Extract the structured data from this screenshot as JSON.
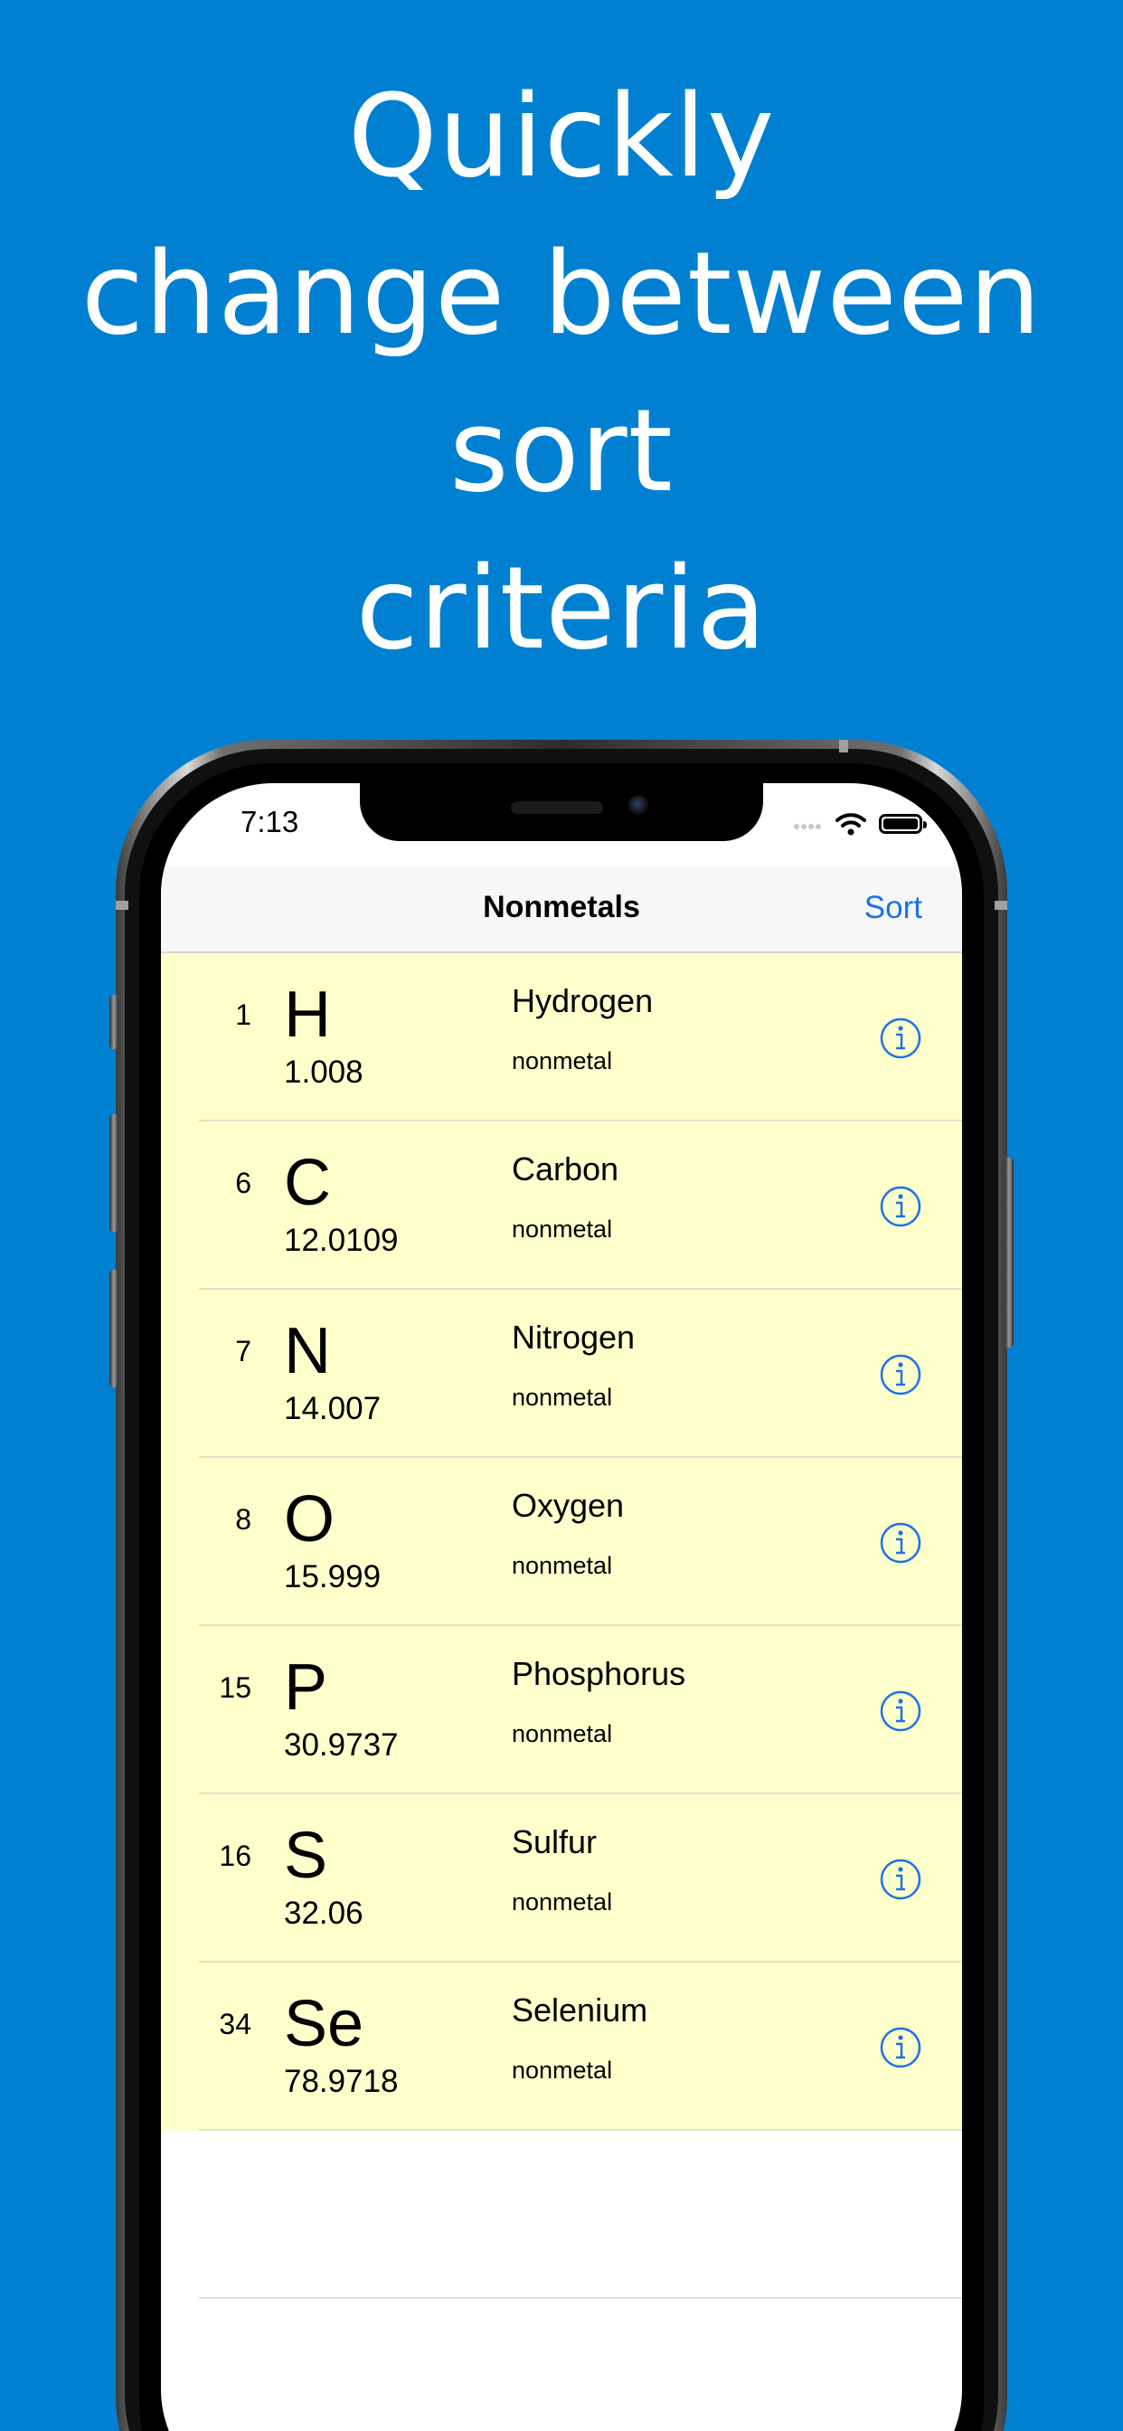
{
  "colors": {
    "background": "#0180d1",
    "accent": "#1a73e8",
    "row_background": "#ffffcc"
  },
  "headline": {
    "lines": [
      "Quickly",
      "change between",
      "sort",
      "criteria"
    ]
  },
  "status_bar": {
    "time": "7:13",
    "icons": [
      "signal-dots-icon",
      "wifi-icon",
      "battery-icon"
    ]
  },
  "navbar": {
    "title": "Nonmetals",
    "sort_label": "Sort"
  },
  "elements": [
    {
      "number": "1",
      "symbol": "H",
      "mass": "1.008",
      "name": "Hydrogen",
      "category": "nonmetal"
    },
    {
      "number": "6",
      "symbol": "C",
      "mass": "12.0109",
      "name": "Carbon",
      "category": "nonmetal"
    },
    {
      "number": "7",
      "symbol": "N",
      "mass": "14.007",
      "name": "Nitrogen",
      "category": "nonmetal"
    },
    {
      "number": "8",
      "symbol": "O",
      "mass": "15.999",
      "name": "Oxygen",
      "category": "nonmetal"
    },
    {
      "number": "15",
      "symbol": "P",
      "mass": "30.9737",
      "name": "Phosphorus",
      "category": "nonmetal"
    },
    {
      "number": "16",
      "symbol": "S",
      "mass": "32.06",
      "name": "Sulfur",
      "category": "nonmetal"
    },
    {
      "number": "34",
      "symbol": "Se",
      "mass": "78.9718",
      "name": "Selenium",
      "category": "nonmetal"
    }
  ]
}
